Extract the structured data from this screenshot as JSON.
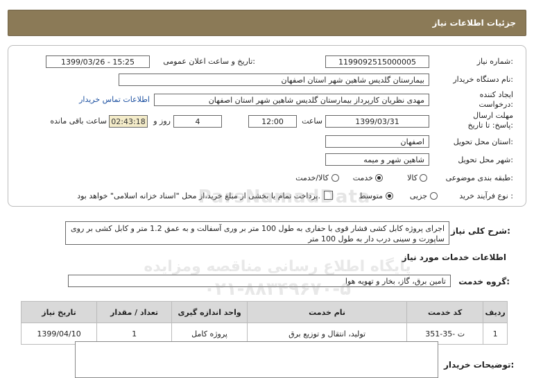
{
  "header": {
    "title": "جزئیات اطلاعات نیاز"
  },
  "fields": {
    "need_number_label": "شماره نیاز:",
    "need_number": "1199092515000005",
    "announce_label": "تاریخ و ساعت اعلان عمومی:",
    "announce_value": "1399/03/26 - 15:25",
    "buyer_label": "نام دستگاه خریدار:",
    "buyer_value": "بیمارستان گلدیس شاهین شهر استان اصفهان",
    "creator_label": "ایجاد کننده درخواست:",
    "creator_value": "مهدی نظریان کارپرداز بیمارستان گلدیس شاهین شهر استان اصفهان",
    "contact_link": "اطلاعات تماس خریدار",
    "deadline_label": "مهلت ارسال پاسخ: تا تاریخ:",
    "deadline_date": "1399/03/31",
    "time_label": "ساعت",
    "deadline_time": "12:00",
    "days_value": "4",
    "days_label": "روز و",
    "remaining_time": "02:43:18",
    "remaining_label": "ساعت باقی مانده",
    "province_label": "استان محل تحویل:",
    "province_value": "اصفهان",
    "city_label": "شهر محل تحویل:",
    "city_value": "شاهین شهر و میمه",
    "category_label": "طبقه بندی موضوعی:",
    "category_options": [
      "کالا",
      "خدمت",
      "کالا/خدمت"
    ],
    "category_selected": "خدمت",
    "process_label": "نوع فرآیند خرید :",
    "process_options": [
      "جزیی",
      "متوسط"
    ],
    "process_selected": "متوسط",
    "payment_note": "پرداخت تمام یا بخشی از مبلغ خرید،از محل \"اسناد خزانه اسلامی\" خواهد بود."
  },
  "summary": {
    "label": "شرح کلی نیاز:",
    "text": "اجرای پروژه کابل کشی فشار قوی با حفاری به طول  100 متر بر وری آسفالت و به عمق 1.2 متر و کابل کشی بر روی ساپورت و سینی درب دار به طول 100 متر"
  },
  "services_section": {
    "title": "اطلاعات خدمات مورد نیاز",
    "group_label": "گروه خدمت:",
    "group_value": "تامین برق، گاز، بخار و تهویه هوا"
  },
  "table": {
    "headers": [
      "ردیف",
      "کد خدمت",
      "نام خدمت",
      "واحد اندازه گیری",
      "تعداد / مقدار",
      "تاریخ نیاز"
    ],
    "rows": [
      [
        "1",
        "ت -35-351",
        "تولید، انتقال و توزیع برق",
        "پروژه کامل",
        "1",
        "1399/04/10"
      ]
    ]
  },
  "notes": {
    "label": "توضیحات خریدار:"
  },
  "watermark": {
    "line1": "ParsNamadData",
    "line2": "پایگاه اطلاع رسانی مناقصه ومزایده",
    "line3": "۰۲۱-۸۸۳۴۹۶۷۰-۵"
  }
}
